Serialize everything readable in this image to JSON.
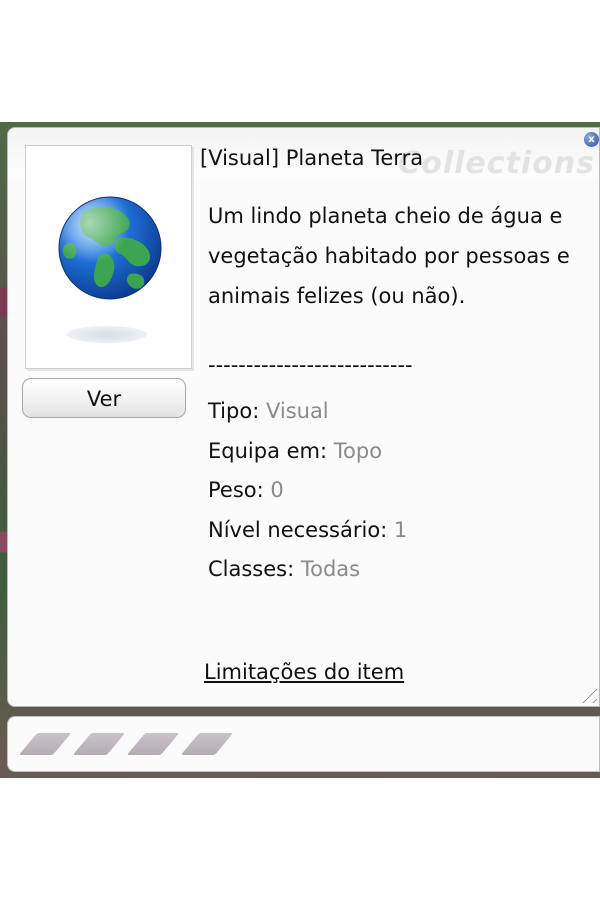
{
  "window": {
    "watermark": "Collections",
    "close_symbol": "x",
    "title": "[Visual] Planeta Terra",
    "view_button_label": "Ver",
    "description": "Um lindo planeta cheio de água e vegetação habitado por pessoas e animais felizes (ou não).",
    "separator": "---------------------------",
    "properties": [
      {
        "label": "Tipo: ",
        "value": "Visual"
      },
      {
        "label": "Equipa em: ",
        "value": "Topo"
      },
      {
        "label": "Peso: ",
        "value": "0"
      },
      {
        "label": "Nível necessário: ",
        "value": "1"
      },
      {
        "label": "Classes: ",
        "value": "Todas"
      }
    ],
    "limits_link": "Limitações do item",
    "item_icon": "earth-globe-icon"
  },
  "slot_bar": {
    "slot_count": 4,
    "slot_icon": "card-slot-icon"
  },
  "colors": {
    "value_gray": "#8a8a8a",
    "close_blue": "#2f4fa5",
    "ocean_blue": "#1f5fc7",
    "land_green": "#3ea24a"
  }
}
